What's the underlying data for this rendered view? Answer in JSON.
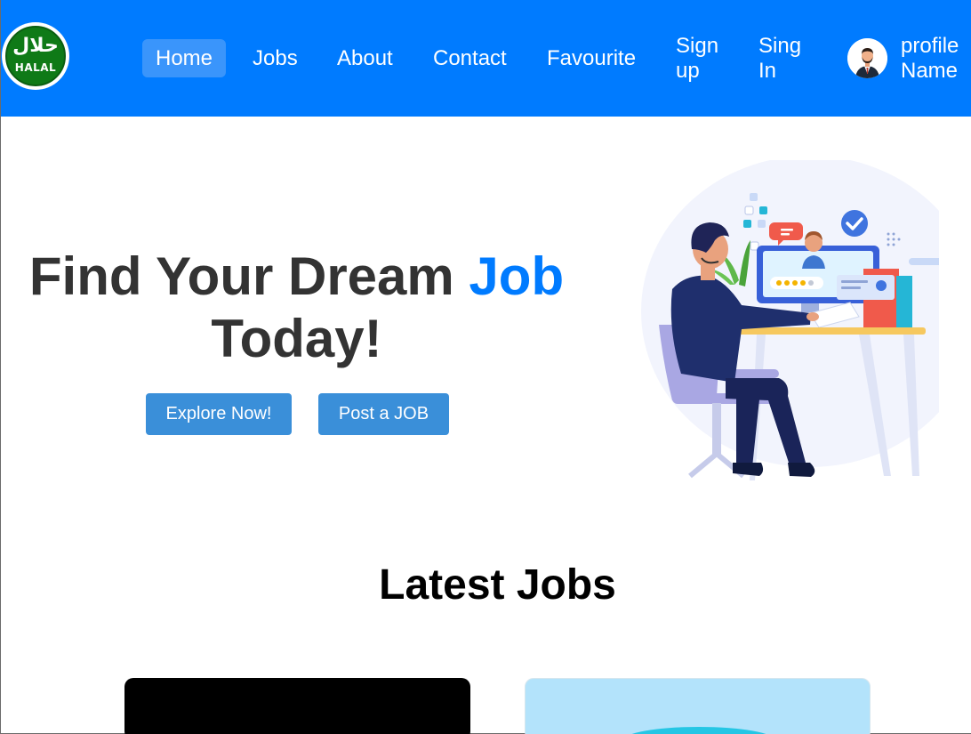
{
  "logo": {
    "arabic": "حلال",
    "text": "HALAL"
  },
  "nav": {
    "home": "Home",
    "jobs": "Jobs",
    "about": "About",
    "contact": "Contact",
    "favourite": "Favourite",
    "signup_line1": "Sign",
    "signup_line2": "up",
    "signin_line1": "Sing",
    "signin_line2": "In",
    "profile_line1": "profile",
    "profile_line2": "Name"
  },
  "hero": {
    "title_part1": "Find Your Dream ",
    "title_accent": "Job",
    "title_part2": "Today!",
    "explore_button": "Explore Now!",
    "post_button": "Post a JOB"
  },
  "latest_jobs": {
    "title": "Latest Jobs"
  },
  "colors": {
    "brand_blue": "#007bff",
    "button_blue": "#3a8fd9",
    "active_nav": "#3a95fb",
    "halal_green": "#0f7a17"
  },
  "icons": [
    "halal-logo",
    "profile-avatar-icon",
    "job-interview-illustration"
  ]
}
